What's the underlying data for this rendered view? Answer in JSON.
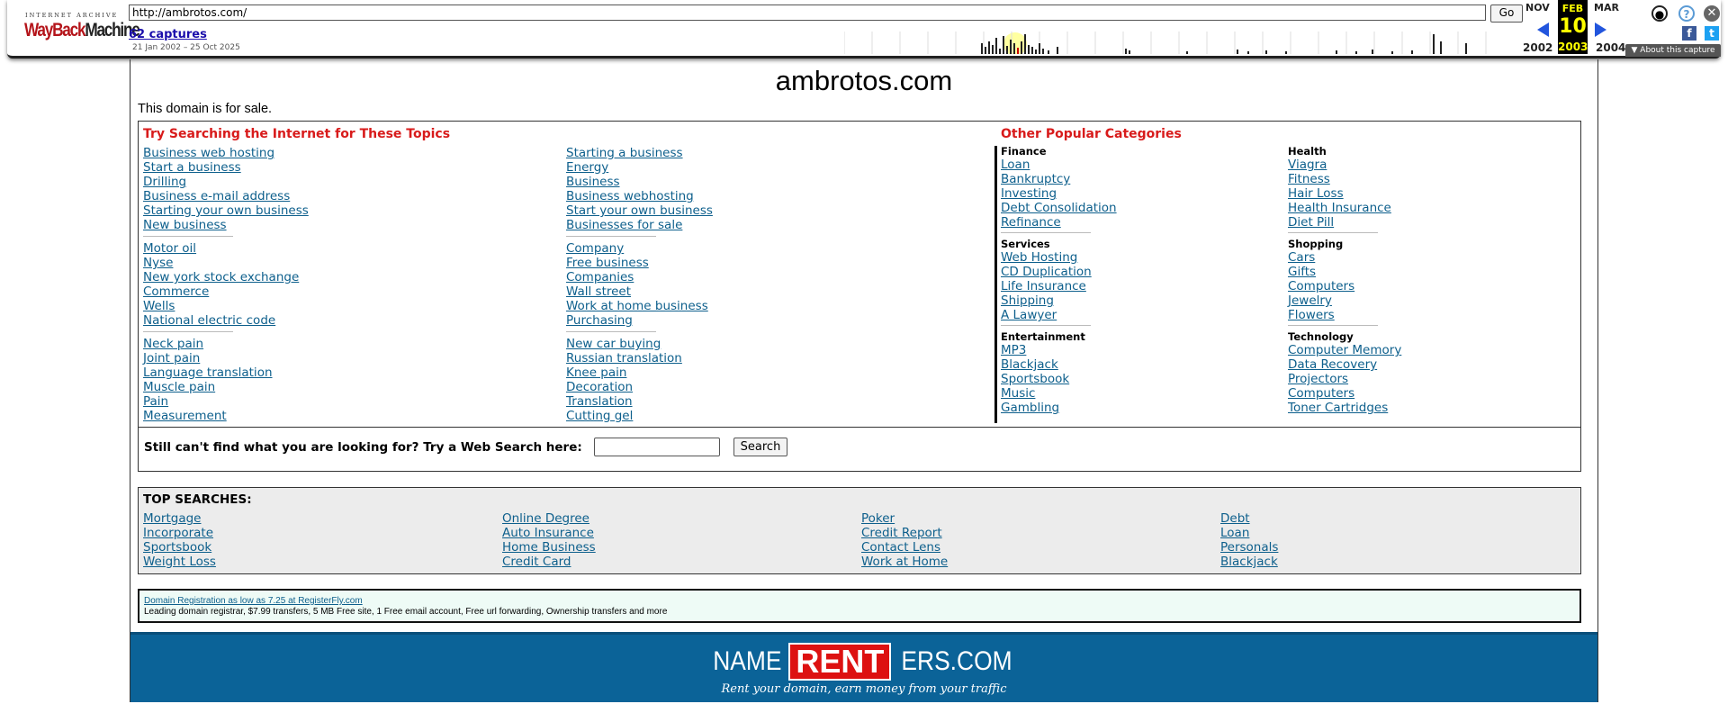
{
  "wayback": {
    "logo_top": "INTERNET ARCHIVE",
    "logo_way": "WayBack",
    "logo_machine": "Machine",
    "url": "http://ambrotos.com/",
    "go_label": "Go",
    "captures_label": "62 captures",
    "date_range": "21 Jan 2002 – 25 Oct 2025",
    "prev_month": "NOV",
    "cur_month": "FEB",
    "next_month": "MAR",
    "cur_day": "10",
    "prev_year": "2002",
    "cur_year": "2003",
    "next_year": "2004",
    "about_label": "▼ About this capture",
    "icons": [
      "user-icon",
      "help-icon",
      "close-icon",
      "facebook-icon",
      "twitter-icon"
    ]
  },
  "site": {
    "title": "ambrotos.com",
    "for_sale": "This domain is for sale."
  },
  "topics": {
    "heading": "Try Searching the Internet for These Topics",
    "col1": [
      [
        "Business web hosting",
        "Start a business",
        "Drilling",
        "Business e-mail address",
        "Starting your own business",
        "New business"
      ],
      [
        "Motor oil",
        "Nyse",
        "New york stock exchange",
        "Commerce",
        "Wells",
        "National electric code"
      ],
      [
        "Neck pain",
        "Joint pain",
        "Language translation",
        "Muscle pain",
        "Pain",
        "Measurement"
      ]
    ],
    "col2": [
      [
        "Starting a business",
        "Energy",
        "Business",
        "Business webhosting",
        "Start your own business",
        "Businesses for sale"
      ],
      [
        "Company",
        "Free business",
        "Companies",
        "Wall street",
        "Work at home business",
        "Purchasing"
      ],
      [
        "New car buying",
        "Russian translation",
        "Knee pain",
        "Decoration",
        "Translation",
        "Cutting gel"
      ]
    ]
  },
  "categories": {
    "heading": "Other Popular Categories",
    "left": [
      {
        "name": "Finance",
        "items": [
          "Loan",
          "Bankruptcy",
          "Investing",
          "Debt Consolidation",
          "Refinance"
        ]
      },
      {
        "name": "Services",
        "items": [
          "Web Hosting",
          "CD Duplication",
          "Life Insurance",
          "Shipping",
          "A Lawyer"
        ]
      },
      {
        "name": "Entertainment",
        "items": [
          "MP3",
          "Blackjack",
          "Sportsbook",
          "Music",
          "Gambling"
        ]
      }
    ],
    "right": [
      {
        "name": "Health",
        "items": [
          "Viagra",
          "Fitness",
          "Hair Loss",
          "Health Insurance",
          "Diet Pill"
        ]
      },
      {
        "name": "Shopping",
        "items": [
          "Cars",
          "Gifts",
          "Computers",
          "Jewelry",
          "Flowers"
        ]
      },
      {
        "name": "Technology",
        "items": [
          "Computer Memory",
          "Data Recovery",
          "Projectors",
          "Computers",
          "Toner Cartridges"
        ]
      }
    ]
  },
  "web_search": {
    "prompt": "Still can't find what you are looking for? Try a Web Search here:",
    "value": "",
    "button": "Search"
  },
  "top_searches": {
    "heading": "TOP SEARCHES:",
    "columns": [
      [
        "Mortgage",
        "Incorporate",
        "Sportsbook",
        "Weight Loss"
      ],
      [
        "Online Degree",
        "Auto Insurance",
        "Home Business",
        "Credit Card"
      ],
      [
        "Poker",
        "Credit Report",
        "Contact Lens",
        "Work at Home"
      ],
      [
        "Debt",
        "Loan",
        "Personals",
        "Blackjack"
      ]
    ]
  },
  "registration": {
    "link": "Domain Registration as low as 7.25 at RegisterFly.com",
    "desc": "Leading domain registrar, $7.99 transfers, 5 MB Free site, 1 Free email account, Free url forwarding, Ownership transfers and more"
  },
  "banner": {
    "part1": "NAME",
    "part2": "RENT",
    "part3": "ERS.COM",
    "tagline": "Rent your domain, earn money from your traffic"
  },
  "colors": {
    "link": "#0d5f8c",
    "heading_red": "#d81b1b",
    "banner_blue": "#0b6398",
    "wayback_yellow": "#ffff00"
  }
}
